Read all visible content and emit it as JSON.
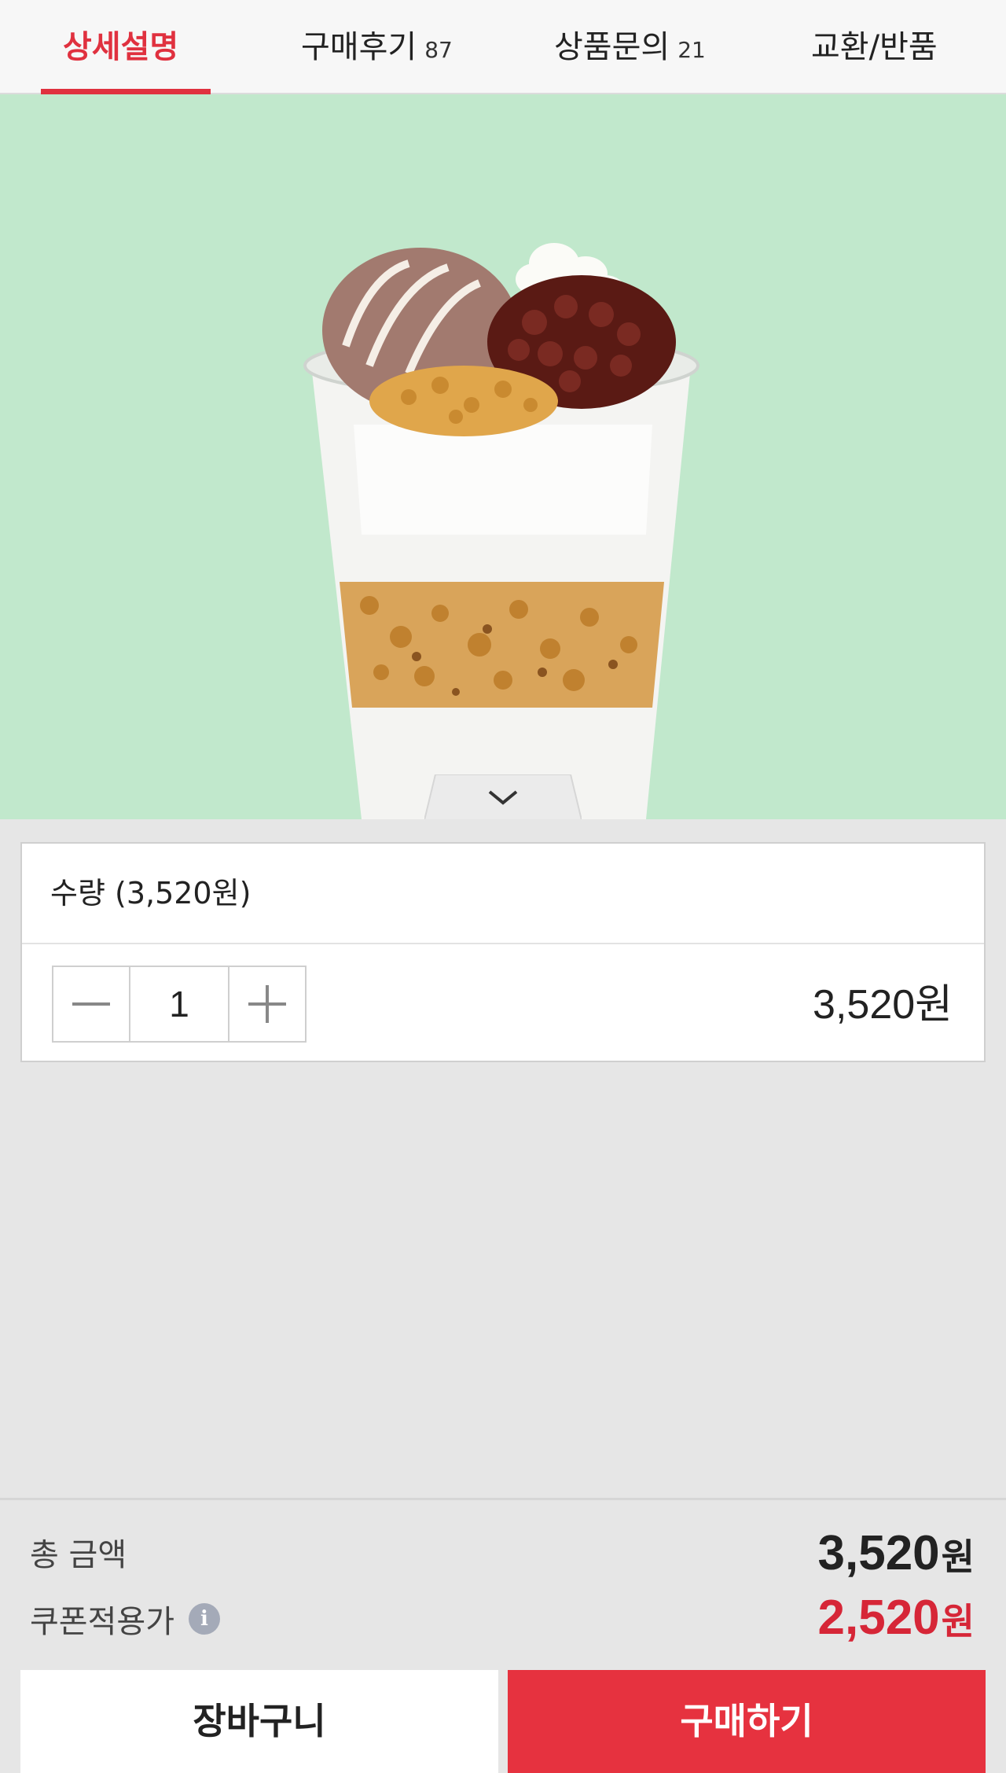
{
  "tabs": [
    {
      "label": "상세설명",
      "count": "",
      "active": true
    },
    {
      "label": "구매후기",
      "count": "87",
      "active": false
    },
    {
      "label": "상품문의",
      "count": "21",
      "active": false
    },
    {
      "label": "교환/반품",
      "count": "",
      "active": false
    }
  ],
  "hero": {
    "background_color": "#c1e8cc",
    "icon": "chevron-down-icon"
  },
  "option": {
    "quantity_label": "수량 (3,520원)",
    "quantity": "1",
    "line_price": "3,520원"
  },
  "summary": {
    "total_label": "총 금액",
    "total_value": "3,520",
    "total_unit": "원",
    "coupon_label": "쿠폰적용가",
    "coupon_info_icon": "i",
    "coupon_value": "2,520",
    "coupon_unit": "원"
  },
  "actions": {
    "cart_label": "장바구니",
    "buy_label": "구매하기"
  },
  "colors": {
    "accent": "#e6323f",
    "coupon": "#d62637"
  }
}
